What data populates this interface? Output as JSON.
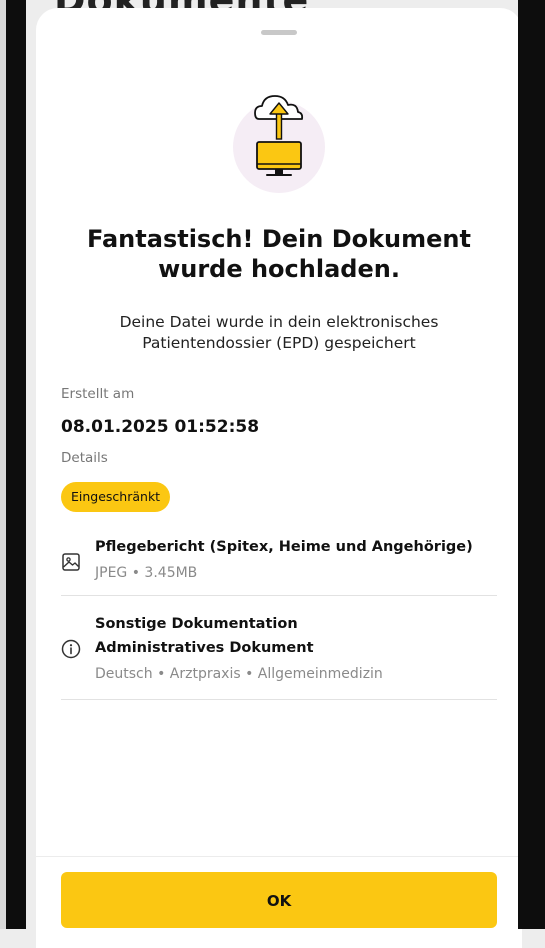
{
  "background": {
    "heading": "Dokumente"
  },
  "modal": {
    "title_line1": "Fantastisch! Dein Dokument",
    "title_line2": "wurde hochladen.",
    "subtitle_line1": "Deine Datei wurde in dein elektronisches",
    "subtitle_line2": "Patientendossier (EPD) gespeichert",
    "created_label": "Erstellt am",
    "created_value": "08.01.2025 01:52:58",
    "details_label": "Details",
    "badge": "Eingeschränkt",
    "file": {
      "icon": "image-file-icon",
      "title": "Pflegebericht (Spitex, Heime und Angehörige)",
      "meta": "JPEG • 3.45MB"
    },
    "info": {
      "icon": "info-icon",
      "title_line1": "Sonstige Dokumentation",
      "title_line2": "Administratives Dokument",
      "meta": "Deutsch • Arztpraxis • Allgemeinmedizin"
    },
    "ok_label": "OK"
  },
  "colors": {
    "accent": "#fbc712",
    "illustration_bg": "#f5edf5"
  }
}
